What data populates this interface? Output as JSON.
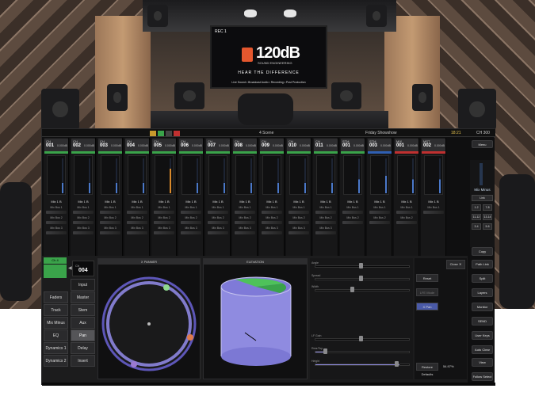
{
  "hero": {
    "rec_label": "REC 1",
    "logo_text": "120dB",
    "logo_sub": "SOUND ENGINEERING",
    "tagline": "HEAR THE DIFFERENCE",
    "services": "Live Sound • Broadcast Audio • Recording • Post Production"
  },
  "topbar": {
    "scene_label": "4  Scene",
    "show_name": "Friday Showshow",
    "clock": "18:21",
    "ch_label": "CH 300",
    "indicators": [
      "#c89b2c",
      "#3aa34a",
      "#444",
      "#c03030"
    ]
  },
  "strips": [
    {
      "type": "CH",
      "num": "001",
      "gain": "0.000dB",
      "color": "#3aa34a",
      "label": "Mix 1 B",
      "sends": [
        "Mix Bus 1",
        "Mix Bus 2",
        "Mix Bus 3"
      ],
      "meter": 0.3
    },
    {
      "type": "CH",
      "num": "002",
      "gain": "0.000dB",
      "color": "#3aa34a",
      "label": "Mix 1 B",
      "sends": [
        "Mix Bus 1",
        "Mix Bus 2",
        "Mix Bus 3"
      ],
      "meter": 0.3
    },
    {
      "type": "CH",
      "num": "003",
      "gain": "0.000dB",
      "color": "#3aa34a",
      "label": "Mix 1 B",
      "sends": [
        "Mix Bus 1",
        "Mix Bus 2",
        "Mix Bus 3"
      ],
      "meter": 0.3
    },
    {
      "type": "CH",
      "num": "004",
      "gain": "0.000dB",
      "color": "#3aa34a",
      "label": "Mix 1 B",
      "sends": [
        "Mix Bus 1",
        "Mix Bus 2",
        "Mix Bus 3"
      ],
      "meter": 0.3
    },
    {
      "type": "CH",
      "num": "005",
      "gain": "0.000dB",
      "color": "#3aa34a",
      "label": "Mix 1 B",
      "sends": [
        "Mix Bus 1",
        "Mix Bus 2",
        "Mix Bus 3"
      ],
      "meter": 0.7
    },
    {
      "type": "CH",
      "num": "006",
      "gain": "0.000dB",
      "color": "#3aa34a",
      "label": "Mix 1 B",
      "sends": [
        "Mix Bus 1",
        "Mix Bus 2",
        "Mix Bus 3"
      ],
      "meter": 0.3
    },
    {
      "type": "CH",
      "num": "007",
      "gain": "0.000dB",
      "color": "#3aa34a",
      "label": "Mix 1 B",
      "sends": [
        "Mix Bus 1",
        "Mix Bus 2",
        "Mix Bus 3"
      ],
      "meter": 0.3
    },
    {
      "type": "CH",
      "num": "008",
      "gain": "0.000dB",
      "color": "#3aa34a",
      "label": "Mix 1 B",
      "sends": [
        "Mix Bus 1",
        "Mix Bus 2",
        "Mix Bus 3"
      ],
      "meter": 0.3
    },
    {
      "type": "CH",
      "num": "009",
      "gain": "0.000dB",
      "color": "#3aa34a",
      "label": "Mix 1 B",
      "sends": [
        "Mix Bus 1",
        "Mix Bus 2",
        "Mix Bus 3"
      ],
      "meter": 0.3
    },
    {
      "type": "CH",
      "num": "010",
      "gain": "0.000dB",
      "color": "#3aa34a",
      "label": "Mix 1 B",
      "sends": [
        "Mix Bus 1",
        "Mix Bus 2",
        "Mix Bus 3"
      ],
      "meter": 0.3
    },
    {
      "type": "CH",
      "num": "011",
      "gain": "0.000dB",
      "color": "#3aa34a",
      "label": "Mix 1 B",
      "sends": [
        "Mix Bus 1",
        "Mix Bus 2",
        "Mix Bus 3"
      ],
      "meter": 0.3
    },
    {
      "type": "STM",
      "num": "001",
      "gain": "0.000dB",
      "color": "#3aa34a",
      "label": "Mix 1 B",
      "sends": [
        "Mix Bus 1",
        "Mix Bus 2"
      ],
      "meter": 0.4
    },
    {
      "type": "STM",
      "num": "003",
      "gain": "0.000dB",
      "color": "#2f5fb3",
      "label": "Mix 1 B",
      "sends": [
        "Mix Bus 1",
        "Mix Bus 2"
      ],
      "meter": 0.5
    },
    {
      "type": "MIX",
      "num": "001",
      "gain": "0.000dB",
      "color": "#c03030",
      "label": "Mix 1 B",
      "sends": [
        "Mix Bus 1",
        "Mix Bus 2"
      ],
      "meter": 0.4
    },
    {
      "type": "MST",
      "num": "002",
      "gain": "0.000dB",
      "color": "#c03030",
      "label": "Mix 1 B",
      "sends": [
        "Mix Bus 1"
      ],
      "meter": 0.4
    }
  ],
  "sidebar": {
    "menu": "Menu",
    "mix_label": "Mix Minus",
    "keys": [
      "Link",
      "1-2",
      "7-8",
      "11-12",
      "13-14",
      "3-4",
      "5-6"
    ],
    "buttons": [
      "Copy",
      "Path Link",
      "Split",
      "Layers",
      "Monitor",
      "SEND",
      "User Keys",
      "Auto Clear",
      "View",
      "Follow Select"
    ]
  },
  "lower": {
    "ch_badge": "Ch 4",
    "ch_num_label": "Ch",
    "ch_num": "004",
    "left_buttons": [
      {
        "label": "Input",
        "state": "dark"
      },
      {
        "label": "Faders",
        "state": ""
      },
      {
        "label": "Master",
        "state": ""
      },
      {
        "label": "Track",
        "state": ""
      },
      {
        "label": "Stem",
        "state": ""
      },
      {
        "label": "Mix Minus",
        "state": ""
      },
      {
        "label": "Aux",
        "state": ""
      },
      {
        "label": "EQ",
        "state": ""
      },
      {
        "label": "Pan",
        "state": "sel"
      },
      {
        "label": "Dynamics 1",
        "state": ""
      },
      {
        "label": "Delay",
        "state": ""
      },
      {
        "label": "Dynamics 2",
        "state": ""
      },
      {
        "label": "Insert",
        "state": ""
      }
    ],
    "xpanner_title": "X PANNER",
    "elevation_title": "ELEVATION",
    "params": [
      {
        "label": "Angle",
        "pos": 0.5
      },
      {
        "label": "Spread",
        "pos": 0.5
      },
      {
        "label": "Width",
        "pos": 0.4
      },
      {
        "label": "LF Gain",
        "pos": 0.5
      },
      {
        "label": "Rear/Top",
        "pos": 0.1
      },
      {
        "label": "Height",
        "pos": 0.9
      }
    ],
    "reset_buttons": [
      "Close",
      "Reset",
      "LFE Mode",
      "X Pan",
      "Restore Defaults"
    ],
    "readout": "54.97%"
  }
}
